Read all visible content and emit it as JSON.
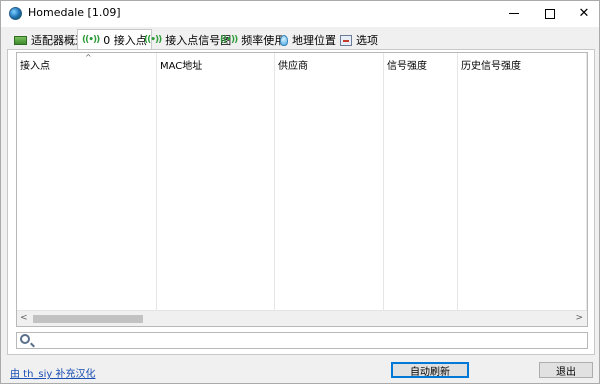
{
  "window": {
    "title": "Homedale [1.09]"
  },
  "tabs": [
    {
      "label": "适配器概述",
      "icon": "network-adapter-icon"
    },
    {
      "label": "0 接入点",
      "icon": "wifi-signal-icon",
      "active": true
    },
    {
      "label": "接入点信号图",
      "icon": "wifi-signal-icon"
    },
    {
      "label": "频率使用",
      "icon": "wifi-signal-icon"
    },
    {
      "label": "地理位置",
      "icon": "location-bulb-icon"
    },
    {
      "label": "选项",
      "icon": "options-icon"
    }
  ],
  "tab_icon_glyph": "((•))",
  "table": {
    "columns": [
      "接入点",
      "MAC地址",
      "供应商",
      "信号强度",
      "历史信号强度"
    ],
    "sort_indicator": "^",
    "rows": []
  },
  "search": {
    "value": "",
    "placeholder": ""
  },
  "scrollbar": {
    "left_arrow": "<",
    "right_arrow": ">"
  },
  "footer": {
    "credit_link": "由 th_siy 补充汉化",
    "refresh_button": "自动刷新",
    "exit_button": "退出"
  },
  "colors": {
    "accent": "#0078d7",
    "link": "#1a4fb4",
    "window_bg": "#f0f0f0"
  }
}
